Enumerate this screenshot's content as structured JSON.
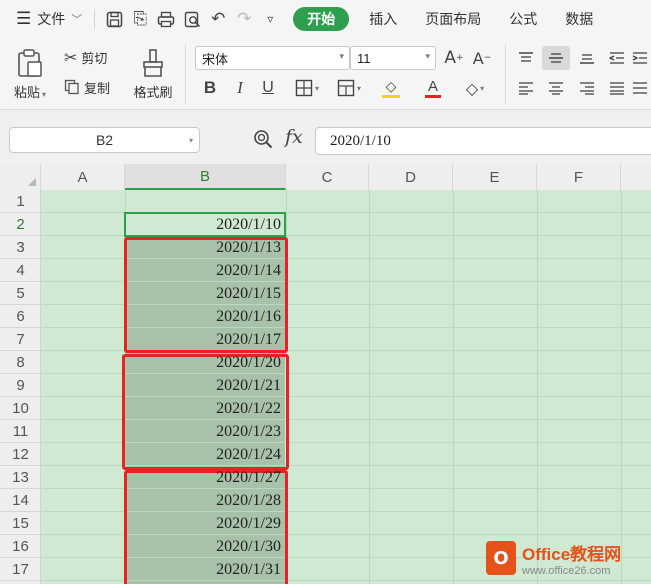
{
  "menubar": {
    "file_label": "文件",
    "tabs": [
      {
        "label": "开始",
        "active": true
      },
      {
        "label": "插入",
        "active": false
      },
      {
        "label": "页面布局",
        "active": false
      },
      {
        "label": "公式",
        "active": false
      },
      {
        "label": "数据",
        "active": false
      }
    ]
  },
  "ribbon": {
    "paste_label": "粘贴",
    "cut_label": "剪切",
    "copy_label": "复制",
    "format_painter_label": "格式刷",
    "font_name": "宋体",
    "font_size": "11"
  },
  "formula_bar": {
    "cell_ref": "B2",
    "fx_label": "fx",
    "content": "2020/1/10"
  },
  "grid": {
    "columns": [
      "A",
      "B",
      "C",
      "D",
      "E",
      "F"
    ],
    "selected_column": "B",
    "rows": [
      "1",
      "2",
      "3",
      "4",
      "5",
      "6",
      "7",
      "8",
      "9",
      "10",
      "11",
      "12",
      "13",
      "14",
      "15",
      "16",
      "17"
    ],
    "values": [
      "",
      "2020/1/10",
      "2020/1/13",
      "2020/1/14",
      "2020/1/15",
      "2020/1/16",
      "2020/1/17",
      "2020/1/20",
      "2020/1/21",
      "2020/1/22",
      "2020/1/23",
      "2020/1/24",
      "2020/1/27",
      "2020/1/28",
      "2020/1/29",
      "2020/1/30",
      "2020/1/31"
    ]
  },
  "colors": {
    "accent": "#2e9f4f",
    "sheet_bg": "#d0e9d2",
    "highlight": "#e82222"
  },
  "watermark": {
    "logo_letter": "O",
    "title": "Office教程网",
    "url": "www.office26.com"
  }
}
